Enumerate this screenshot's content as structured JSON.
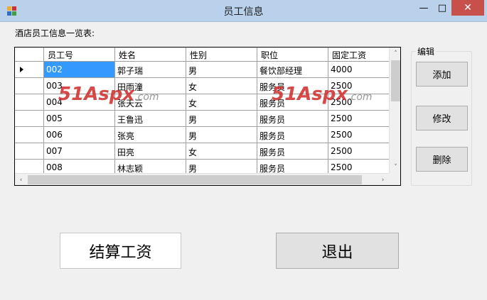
{
  "window": {
    "title": "员工信息",
    "min_glyph": "—",
    "max_glyph": "□",
    "close_glyph": "✕",
    "icon": "app-window-icon"
  },
  "caption": "酒店员工信息一览表:",
  "grid": {
    "columns": [
      "员工号",
      "姓名",
      "性别",
      "职位",
      "固定工资"
    ],
    "rows": [
      [
        "002",
        "郭子瑞",
        "男",
        "餐饮部经理",
        "4000"
      ],
      [
        "003",
        "田雨潼",
        "女",
        "服务员",
        "2500"
      ],
      [
        "004",
        "张天云",
        "女",
        "服务员",
        "2500"
      ],
      [
        "005",
        "王鲁迅",
        "男",
        "服务员",
        "2500"
      ],
      [
        "006",
        "张亮",
        "男",
        "服务员",
        "2500"
      ],
      [
        "007",
        "田亮",
        "女",
        "服务员",
        "2500"
      ],
      [
        "008",
        "林志颖",
        "男",
        "服务员",
        "2500"
      ]
    ],
    "selected_row": 0,
    "scroll_up": "˄",
    "scroll_down": "˅",
    "scroll_left": "‹",
    "scroll_right": "›"
  },
  "edit_group": {
    "legend": "编辑",
    "add_label": "添加",
    "modify_label": "修改",
    "delete_label": "删除"
  },
  "buttons": {
    "calculate_label": "结算工资",
    "exit_label": "退出"
  },
  "watermark": {
    "num": "51",
    "name": "Aspx",
    "domain": ".com"
  },
  "colors": {
    "titlebar": "#b9d1ea",
    "close": "#c7504b",
    "selection": "#3399ff"
  }
}
